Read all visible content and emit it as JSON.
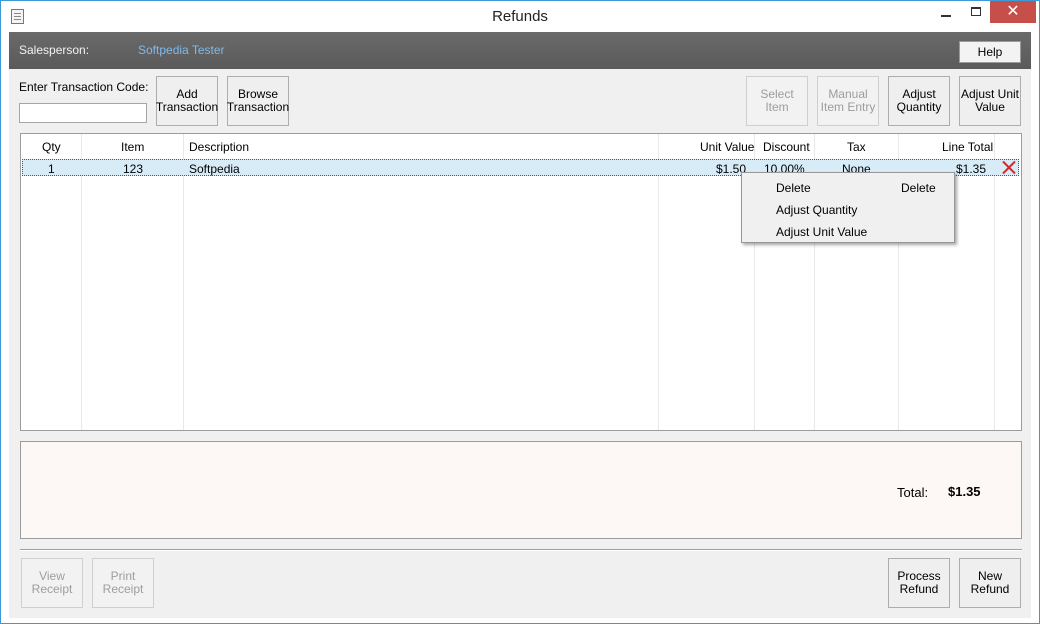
{
  "window": {
    "title": "Refunds"
  },
  "salesperson": {
    "label": "Salesperson:",
    "name": "Softpedia Tester",
    "help_label": "Help"
  },
  "transaction": {
    "code_label": "Enter Transaction Code:",
    "code_value": ""
  },
  "toolbar": {
    "add_transaction": "Add Transaction",
    "browse_transaction": "Browse Transaction",
    "select_item": "Select Item",
    "manual_item_entry": "Manual Item Entry",
    "adjust_quantity": "Adjust Quantity",
    "adjust_unit_value": "Adjust Unit Value"
  },
  "table": {
    "columns": [
      "Qty",
      "Item",
      "Description",
      "Unit Value",
      "Discount",
      "Tax",
      "Line Total"
    ],
    "rows": [
      {
        "qty": "1",
        "item": "123",
        "description": "Softpedia",
        "unit_value": "$1.50",
        "discount": "10.00%",
        "tax": "None",
        "line_total": "$1.35"
      }
    ]
  },
  "context_menu": {
    "items": [
      "Delete",
      "Adjust Quantity",
      "Adjust Unit Value"
    ],
    "delete_shortcut": "Delete"
  },
  "totals": {
    "label": "Total:",
    "value": "$1.35"
  },
  "footer": {
    "view_receipt": "View Receipt",
    "print_receipt": "Print Receipt",
    "process_refund": "Process Refund",
    "new_refund": "New Refund"
  },
  "colors": {
    "accent_blue": "#7fb9ea",
    "selection": "#d8ecf8",
    "delete_red": "#d42a2a",
    "close_btn": "#c74f4a"
  }
}
